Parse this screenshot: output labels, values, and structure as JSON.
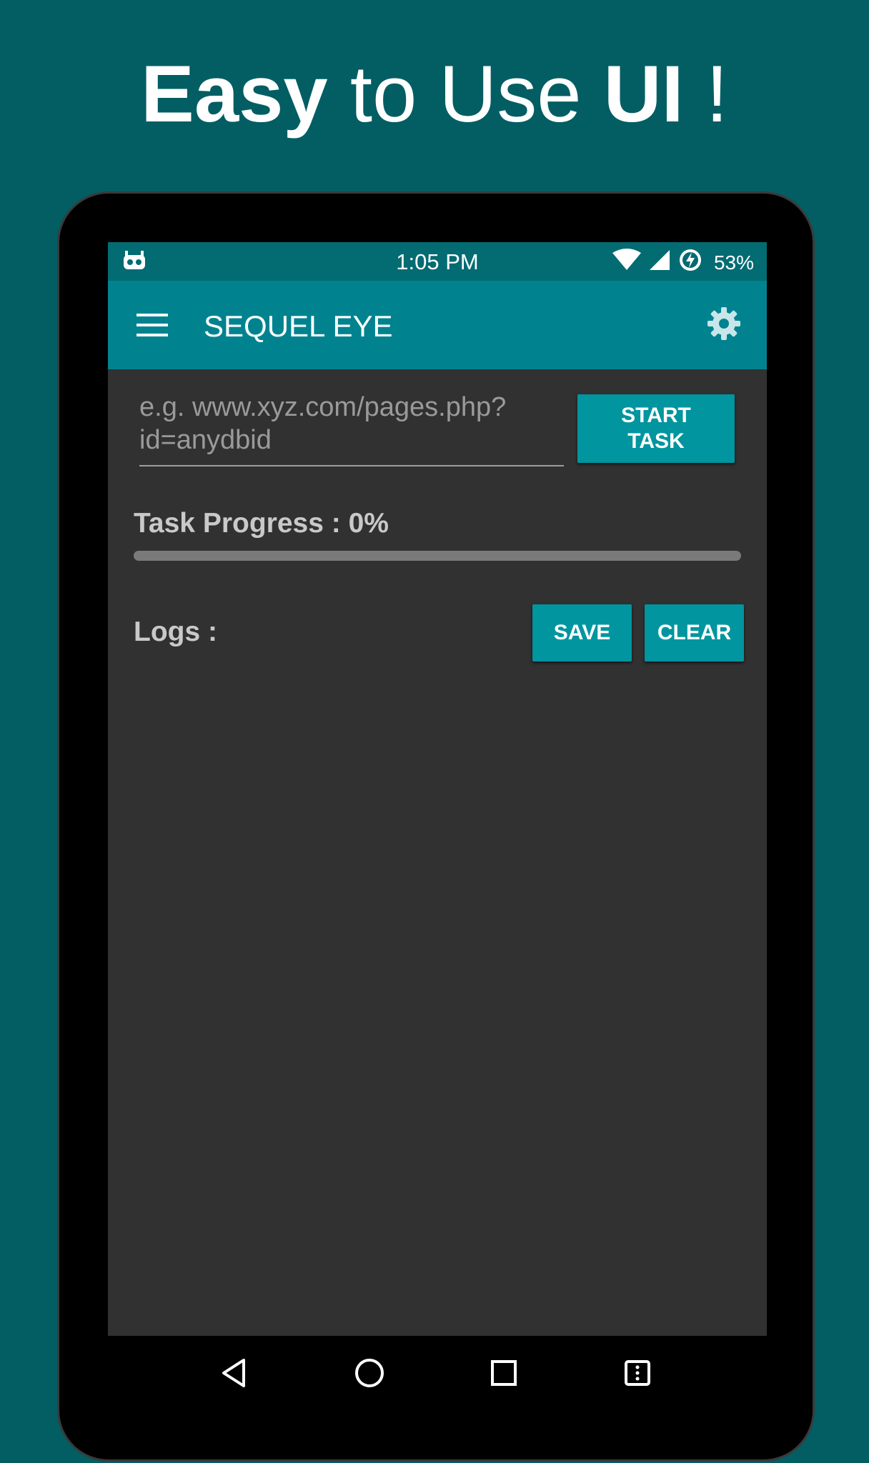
{
  "headline": {
    "part1": "Easy",
    "part2": " to Use ",
    "part3": "UI",
    "part4": " !"
  },
  "status_bar": {
    "time": "1:05 PM",
    "battery": "53%"
  },
  "app_bar": {
    "title": "SEQUEL EYE",
    "menu_icon": "hamburger-menu-icon",
    "settings_icon": "gear-icon"
  },
  "task": {
    "url_placeholder": "e.g. www.xyz.com/pages.php?\nid=anydbid",
    "start_label": "START\nTASK",
    "progress_label": "Task Progress : 0%",
    "progress_fraction": 0
  },
  "logs": {
    "label": "Logs :",
    "save_label": "SAVE",
    "clear_label": "CLEAR",
    "entries": []
  },
  "colors": {
    "accent": "#00959f",
    "appbar": "#00838f",
    "statusbar": "#036b72",
    "background": "#025e63",
    "panel": "#313131"
  }
}
